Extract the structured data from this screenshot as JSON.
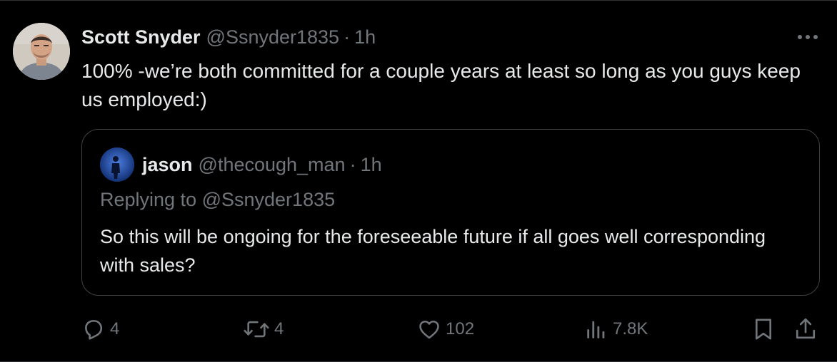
{
  "tweet": {
    "display_name": "Scott Snyder",
    "handle": "@Ssnyder1835",
    "separator": "·",
    "time": "1h",
    "text": "100% -we’re both committed for a couple years at least so long as you guys keep us employed:)",
    "avatar_icon": "person-avatar-photo",
    "more_icon": "more-horizontal-icon"
  },
  "quote": {
    "display_name": "jason",
    "handle": "@thecough_man",
    "separator": "·",
    "time": "1h",
    "reply_prefix": "Replying to ",
    "reply_handle": "@Ssnyder1835",
    "text": "So this will be ongoing for the foreseeable future if all goes well corresponding with sales?",
    "avatar_icon": "person-silhouette-avatar"
  },
  "actions": {
    "reply_count": "4",
    "retweet_count": "4",
    "like_count": "102",
    "view_count": "7.8K",
    "icons": [
      "reply-icon",
      "retweet-icon",
      "like-icon",
      "views-icon",
      "bookmark-icon",
      "share-icon"
    ]
  },
  "colors": {
    "background": "#000000",
    "primary_text": "#e7e9ea",
    "secondary_text": "#71767b",
    "border": "#2f3336"
  }
}
